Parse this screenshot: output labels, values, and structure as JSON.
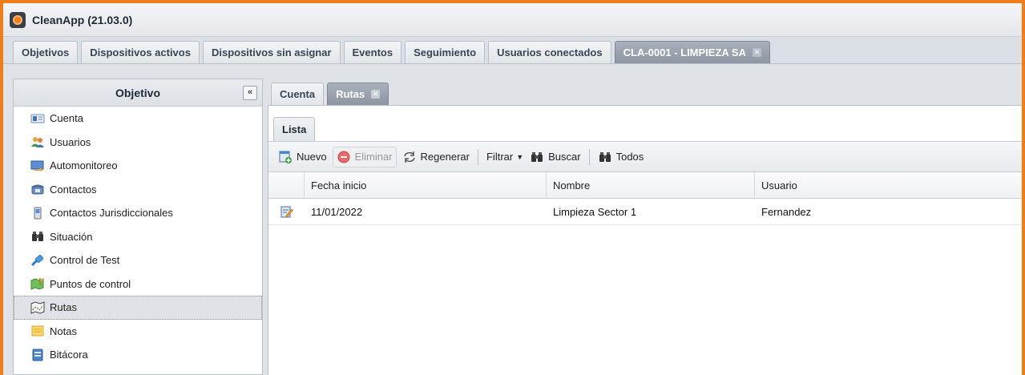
{
  "app": {
    "title": "CleanApp (21.03.0)",
    "accent": "#f07d1a"
  },
  "main_tabs": [
    {
      "label": "Objetivos"
    },
    {
      "label": "Dispositivos activos"
    },
    {
      "label": "Dispositivos sin asignar"
    },
    {
      "label": "Eventos"
    },
    {
      "label": "Seguimiento"
    },
    {
      "label": "Usuarios conectados"
    },
    {
      "label": "CLA-0001 - LIMPIEZA SA",
      "active": true,
      "closable": true
    }
  ],
  "sidebar": {
    "title": "Objetivo",
    "collapse_label": "«",
    "items": [
      {
        "label": "Cuenta",
        "icon": "id-card-icon"
      },
      {
        "label": "Usuarios",
        "icon": "users-icon"
      },
      {
        "label": "Automonitoreo",
        "icon": "monitor-icon"
      },
      {
        "label": "Contactos",
        "icon": "phone-icon"
      },
      {
        "label": "Contactos Jurisdiccionales",
        "icon": "mobile-phone-icon"
      },
      {
        "label": "Situación",
        "icon": "binoculars-icon"
      },
      {
        "label": "Control de Test",
        "icon": "plug-icon"
      },
      {
        "label": "Puntos de control",
        "icon": "map-flag-icon"
      },
      {
        "label": "Rutas",
        "icon": "route-map-icon",
        "selected": true
      },
      {
        "label": "Notas",
        "icon": "note-icon"
      },
      {
        "label": "Bitácora",
        "icon": "logbook-icon"
      }
    ]
  },
  "sub_tabs": [
    {
      "label": "Cuenta"
    },
    {
      "label": "Rutas",
      "active": true,
      "closable": true
    }
  ],
  "inner_tab": {
    "label": "Lista"
  },
  "toolbar": {
    "new_label": "Nuevo",
    "delete_label": "Eliminar",
    "regenerate_label": "Regenerar",
    "filter_label": "Filtrar",
    "search_label": "Buscar",
    "all_label": "Todos"
  },
  "grid": {
    "columns": [
      "Fecha inicio",
      "Nombre",
      "Usuario"
    ],
    "rows": [
      {
        "fecha": "11/01/2022",
        "nombre": "Limpieza Sector 1",
        "usuario": "Fernandez"
      }
    ]
  }
}
